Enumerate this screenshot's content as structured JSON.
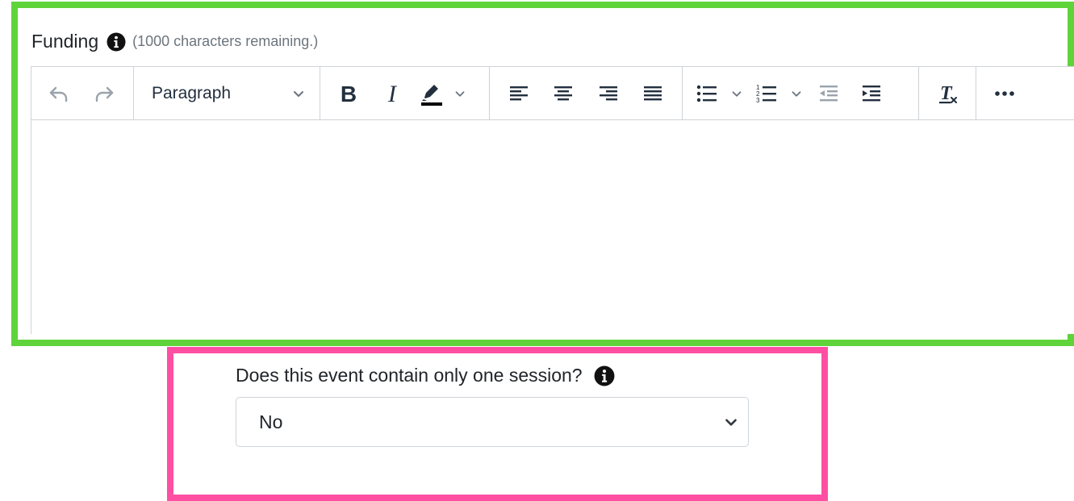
{
  "funding": {
    "label": "Funding",
    "helper_text": "(1000 characters remaining.)",
    "info_icon": "info-circle-icon"
  },
  "editor": {
    "block_format": "Paragraph",
    "toolbar_icons": [
      "undo-icon",
      "redo-icon",
      "bold-icon",
      "italic-icon",
      "highlight-color-icon",
      "align-left-icon",
      "align-center-icon",
      "align-right-icon",
      "align-justify-icon",
      "bullet-list-icon",
      "numbered-list-icon",
      "outdent-icon",
      "indent-icon",
      "clear-formatting-icon",
      "more-icon"
    ],
    "content": ""
  },
  "session": {
    "question": "Does this event contain only one session?",
    "info_icon": "info-circle-icon",
    "selected": "No"
  },
  "colors": {
    "green_highlight": "#5fd33a",
    "pink_highlight": "#ff4fa3",
    "toolbar_icon": "#222f3e",
    "disabled_icon": "#9aa3ab"
  }
}
